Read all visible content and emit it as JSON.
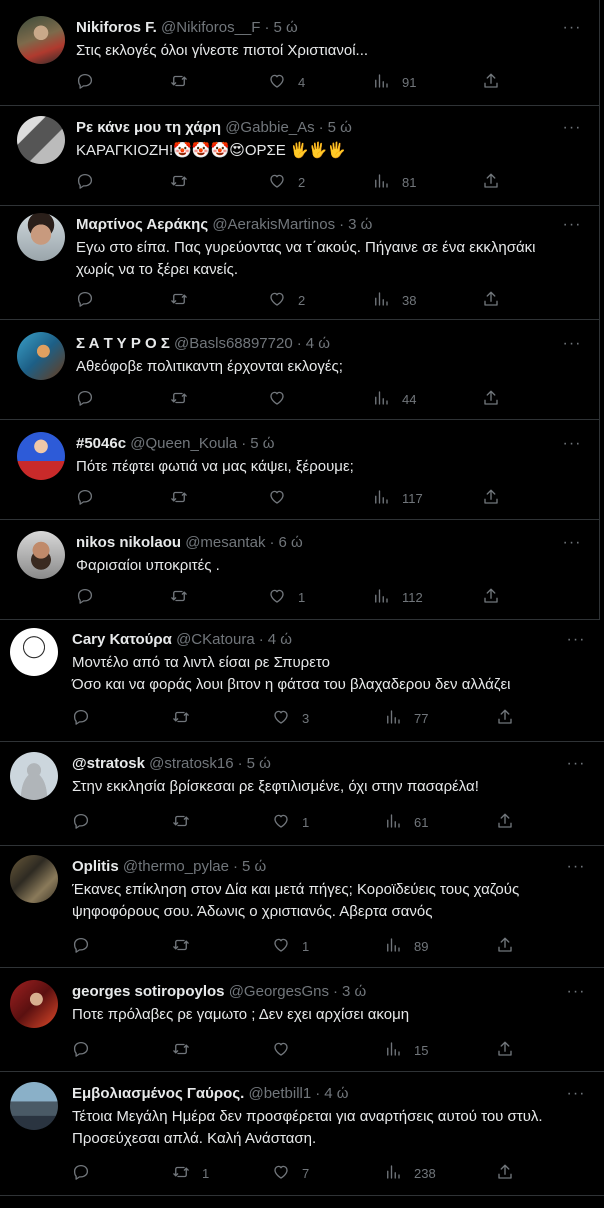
{
  "tweets": [
    {
      "name": "Nikiforos F.",
      "handle": "@Nikiforos__F",
      "time": "5 ώ",
      "text": "Στις εκλογές όλοι γίνεστε πιστοί Χριστιανοί...",
      "replies": "",
      "retweets": "",
      "likes": "4",
      "views": "91",
      "avatar": "painting-avatar"
    },
    {
      "name": "Ρε κάνε μου τη χάρη",
      "handle": "@Gabbie_As",
      "time": "5 ώ",
      "text": "ΚΑΡΑΓΚΙΟΖΗ!🤡🤡🤡😍ΟΡΣΕ 🖐🖐🖐",
      "replies": "",
      "retweets": "",
      "likes": "2",
      "views": "81",
      "avatar": "bw-photo-avatar"
    },
    {
      "name": "Μαρτίνος Αεράκης",
      "handle": "@AerakisMartinos",
      "time": "3 ώ",
      "text": "Εγω στο είπα. Πας γυρεύοντας να τ΄ακούς. Πήγαινε σε ένα εκκλησάκι\nχωρίς να το ξέρει κανείς.",
      "replies": "",
      "retweets": "",
      "likes": "2",
      "views": "38",
      "avatar": "man-portrait-avatar"
    },
    {
      "name": "Σ Α Τ Υ Ρ Ο Σ",
      "handle": "@Basls68897720",
      "time": "4 ώ",
      "text": "Αθεόφοβε πολιτικαντη έρχονται εκλογές;",
      "replies": "",
      "retweets": "",
      "likes": "",
      "views": "44",
      "avatar": "cartoon-hero-avatar"
    },
    {
      "name": "#5046c",
      "handle": "@Queen_Koula",
      "time": "5 ώ",
      "text": "Πότε πέφτει φωτιά να μας κάψει, ξέρουμε;",
      "replies": "",
      "retweets": "",
      "likes": "",
      "views": "117",
      "avatar": "superman-avatar"
    },
    {
      "name": "nikos nikolaou",
      "handle": "@mesantak",
      "time": "6 ώ",
      "text": "Φαρισαίοι υποκριτές .",
      "replies": "",
      "retweets": "",
      "likes": "1",
      "views": "112",
      "avatar": "bearded-man-avatar"
    },
    {
      "name": "Cary Κατούρα",
      "handle": "@CKatoura",
      "time": "4 ώ",
      "text": "Μοντέλο από τα λιντλ είσαι ρε Σπυρετο\nΌσο και να φοράς λουι βιτον η φάτσα του βλαχαδερου δεν αλλάζει",
      "replies": "",
      "retweets": "",
      "likes": "3",
      "views": "77",
      "avatar": "sketch-avatar"
    },
    {
      "name": "@stratosk",
      "handle": "@stratosk16",
      "time": "5 ώ",
      "text": "Στην εκκλησία βρίσκεσαι ρε ξεφτιλισμένε, όχι στην πασαρέλα!",
      "replies": "",
      "retweets": "",
      "likes": "1",
      "views": "61",
      "avatar": "default-avatar"
    },
    {
      "name": "Oplitis",
      "handle": "@thermo_pylae",
      "time": "5 ώ",
      "text": "Έκανες επίκληση στον Δία και μετά πήγες; Κοροϊδεύεις τους χαζούς\nψηφοφόρους σου. Άδωνις ο χριστιανός. Αβερτα σανός",
      "replies": "",
      "retweets": "",
      "likes": "1",
      "views": "89",
      "avatar": "warriors-avatar"
    },
    {
      "name": "georges sotiropoylos",
      "handle": "@GeorgesGns",
      "time": "3 ώ",
      "text": "Ποτε πρόλαβες ρε γαμωτο ; Δεν εχει αρχίσει ακομη",
      "replies": "",
      "retweets": "",
      "likes": "",
      "views": "15",
      "avatar": "red-photo-avatar"
    },
    {
      "name": "Εμβολιασμένος Γαύρος.",
      "handle": "@betbill1",
      "time": "4 ώ",
      "text": "Τέτοια Μεγάλη Ημέρα δεν προσφέρεται για αναρτήσεις αυτού του στυλ.\nΠροσεύχεσαι απλά. Καλή Ανάσταση.",
      "replies": "",
      "retweets": "1",
      "likes": "7",
      "views": "238",
      "avatar": "city-avatar"
    }
  ],
  "colors": {
    "background": "#000000",
    "text": "#e7e9ea",
    "muted": "#71767b",
    "divider": "#2f3336"
  },
  "icons": {
    "more": "more-icon",
    "reply": "reply-icon",
    "retweet": "retweet-icon",
    "like": "like-icon",
    "views": "views-icon",
    "share": "share-icon"
  }
}
